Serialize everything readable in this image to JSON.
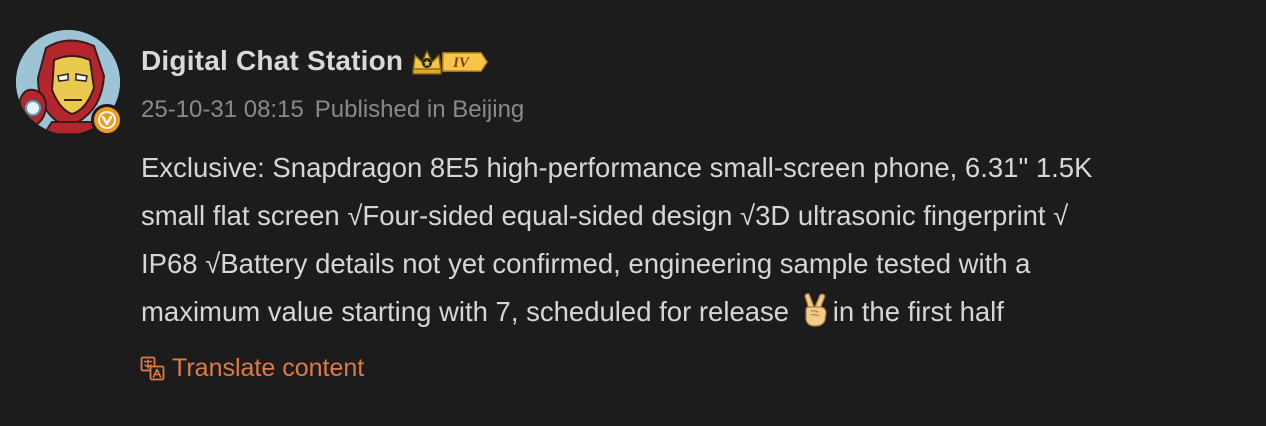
{
  "post": {
    "author": {
      "name": "Digital Chat Station",
      "level_badge": "IV",
      "avatar_icon": "iron-man-avatar",
      "verified_icon": "verified-v-badge",
      "verified_letter": "v"
    },
    "meta": {
      "timestamp": "25-10-31 08:15",
      "location": "Published in Beijing"
    },
    "content": {
      "lines": [
        "Exclusive: Snapdragon 8E5 high-performance small-screen phone, 6.31\" 1.5K",
        "small flat screen √Four-sided equal-sided design √3D ultrasonic fingerprint √",
        "IP68 √Battery details not yet confirmed, engineering sample tested with a"
      ],
      "last_line_before_emoji": "maximum value starting with 7, scheduled for release ",
      "last_line_after_emoji": "in the first half",
      "emoji": "victory-hand-emoji"
    },
    "translate": {
      "label": "Translate content",
      "icon": "translate-icon"
    },
    "colors": {
      "background": "#1c1c1c",
      "username": "#d9d9d9",
      "meta": "#8a8a8a",
      "body_text": "#d6d6d6",
      "translate_accent": "#e07a45",
      "verified_badge": "#f39a1c"
    }
  }
}
